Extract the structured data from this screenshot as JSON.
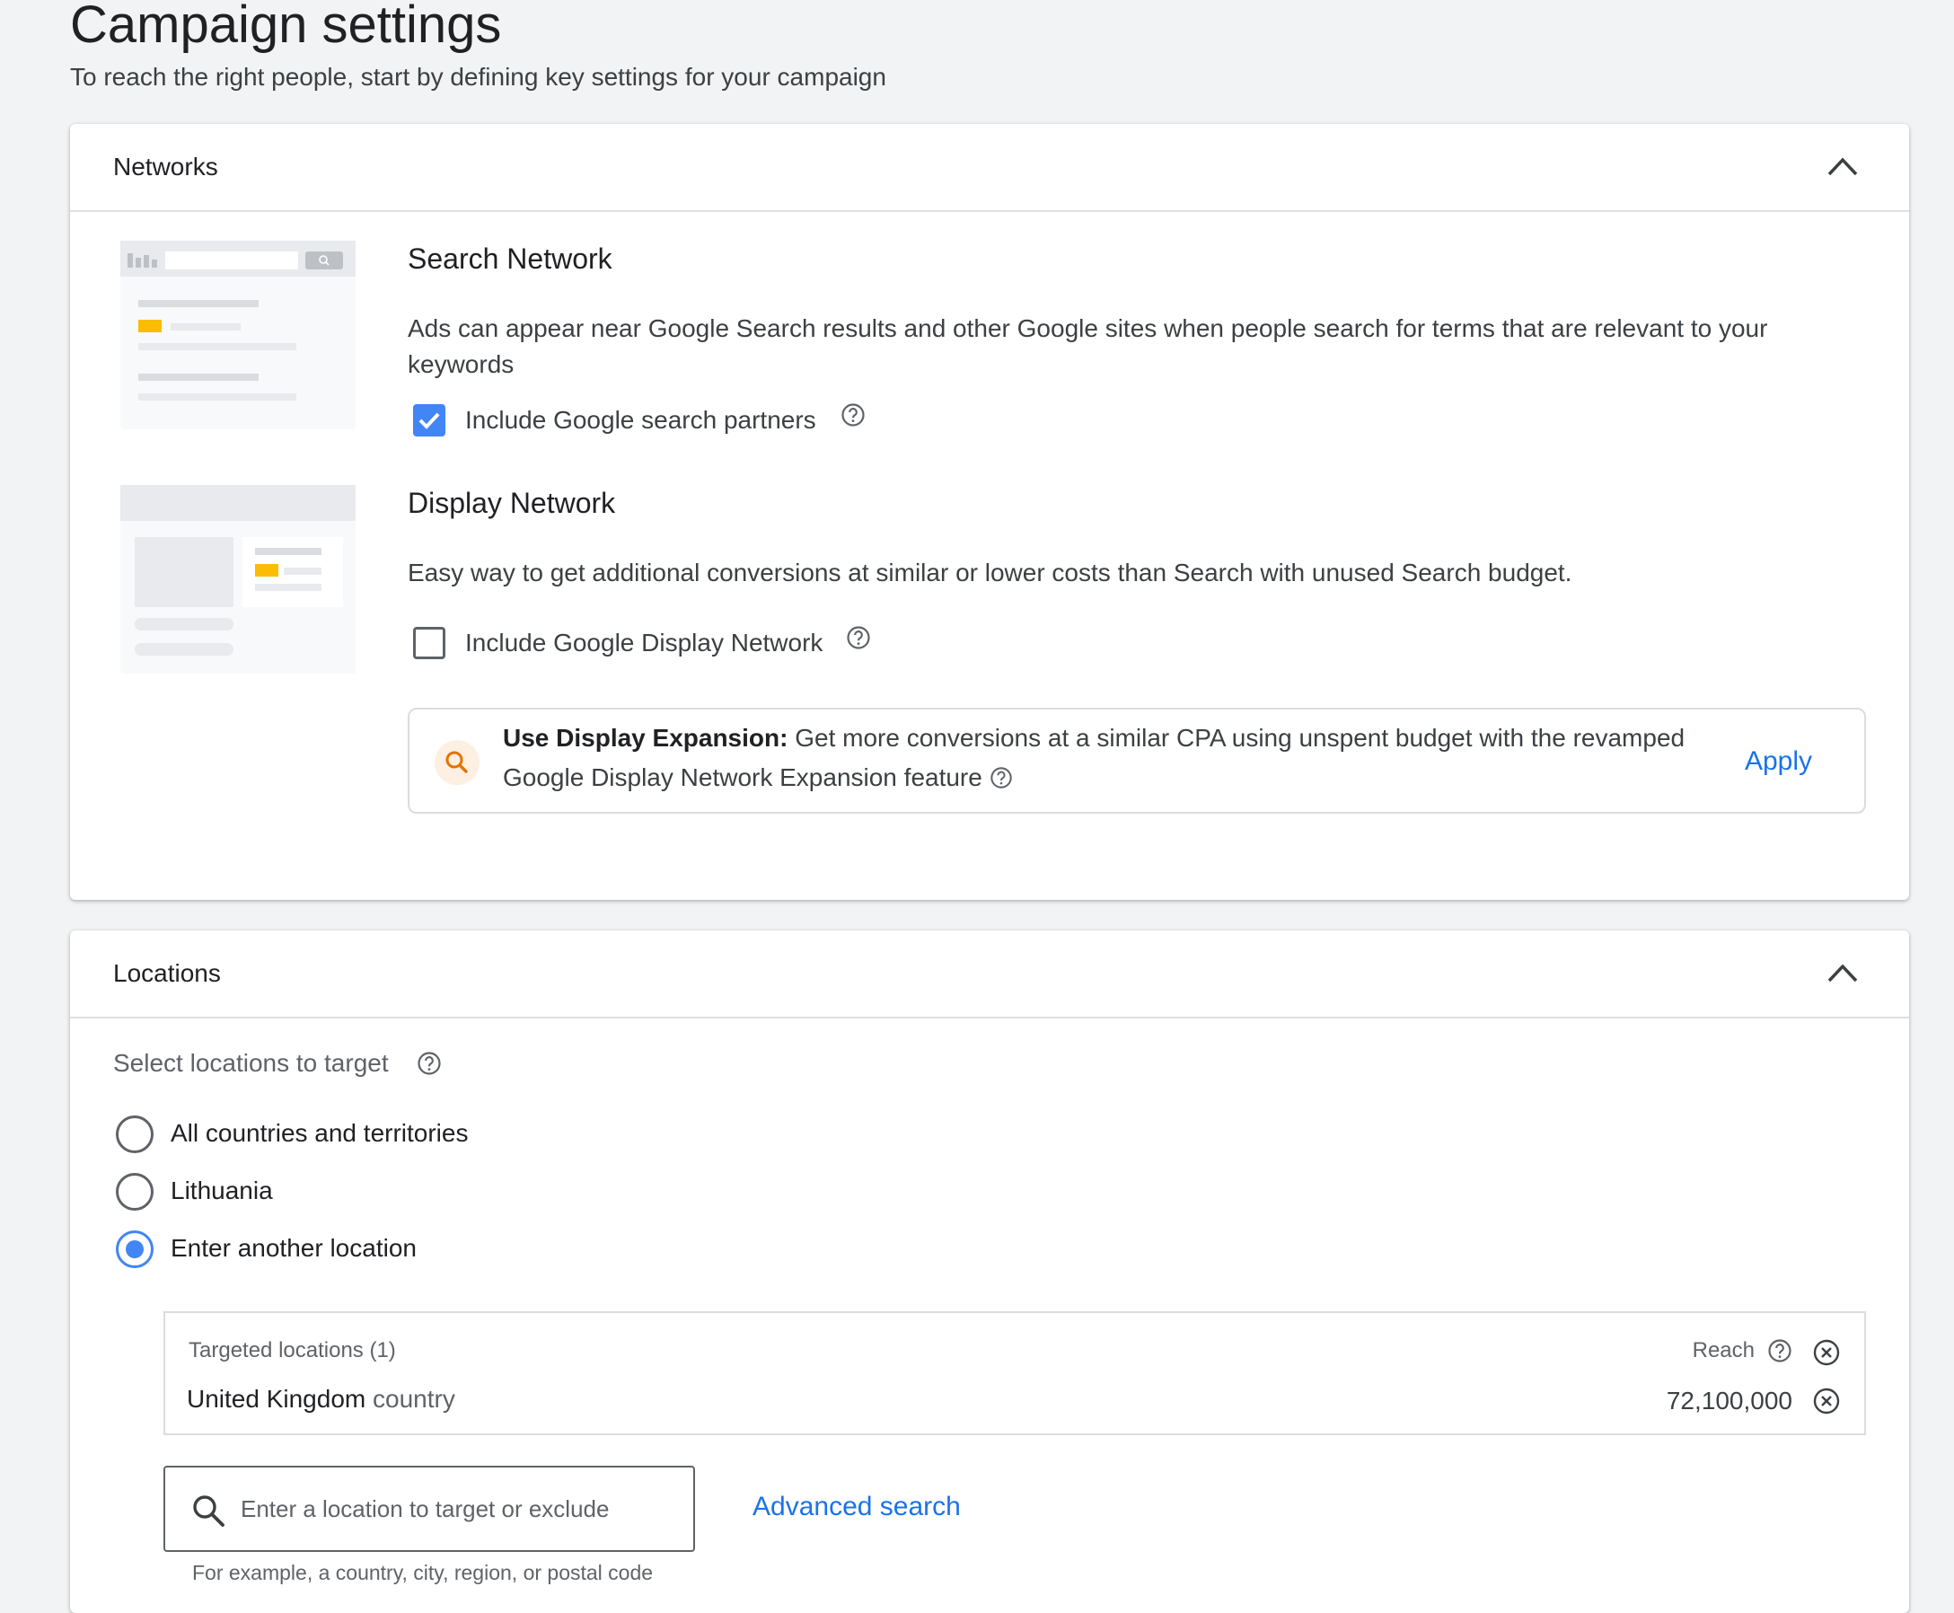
{
  "page": {
    "title": "Campaign settings",
    "subtitle": "To reach the right people, start by defining key settings for your campaign"
  },
  "networks": {
    "header": "Networks",
    "collapse_icon": "chevron-up-icon",
    "search_network": {
      "title": "Search Network",
      "description": "Ads can appear near Google Search results and other Google sites when people search for terms that are relevant to your keywords",
      "checkbox_label": "Include Google search partners",
      "checked": true
    },
    "display_network": {
      "title": "Display Network",
      "description": "Easy way to get additional conversions at similar or lower costs than Search with unused Search budget.",
      "checkbox_label": "Include Google Display Network",
      "checked": false
    },
    "expansion": {
      "bold": "Use Display Expansion:",
      "text": " Get more conversions at a similar CPA using unspent budget with the revamped Google Display Network Expansion feature",
      "apply": "Apply",
      "icon": "search-icon",
      "icon_color": "#e37400"
    }
  },
  "locations": {
    "header": "Locations",
    "collapse_icon": "chevron-up-icon",
    "prompt": "Select locations to target",
    "options": [
      {
        "label": "All countries and territories",
        "selected": false
      },
      {
        "label": "Lithuania",
        "selected": false
      },
      {
        "label": "Enter another location",
        "selected": true
      }
    ],
    "targeted": {
      "header": "Targeted locations (1)",
      "reach_label": "Reach",
      "rows": [
        {
          "name": "United Kingdom",
          "type": "country",
          "reach": "72,100,000"
        }
      ]
    },
    "search": {
      "placeholder": "Enter a location to target or exclude",
      "hint": "For example, a country, city, region, or postal code",
      "advanced": "Advanced search"
    }
  },
  "colors": {
    "accent": "#1a73e8",
    "checkbox": "#4285f4",
    "thumb_highlight": "#fbbc04"
  }
}
